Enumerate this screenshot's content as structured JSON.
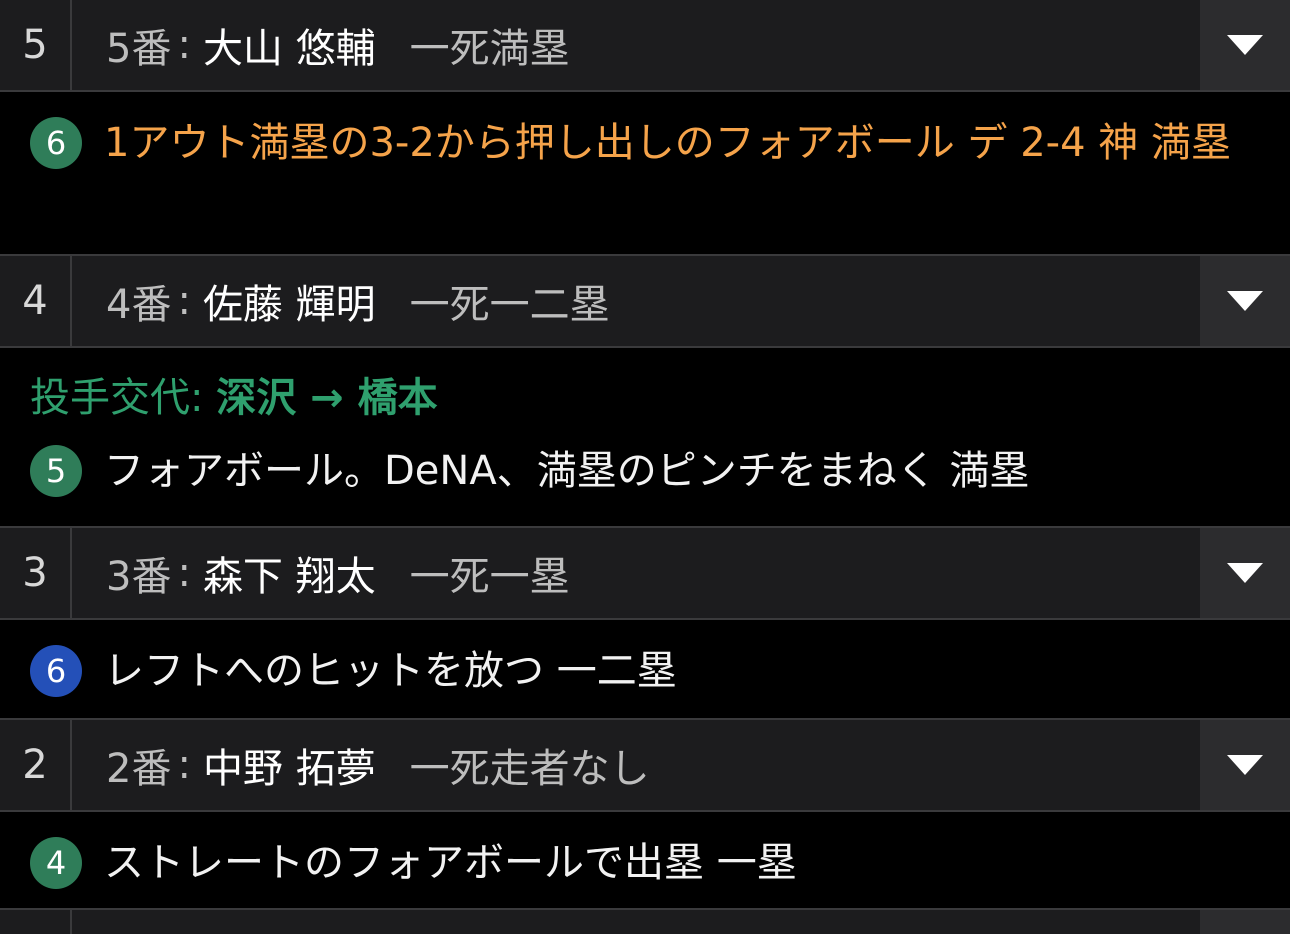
{
  "rows": [
    {
      "order": "5",
      "batter_label": "5番",
      "sep": ":",
      "name": "大山 悠輔",
      "outs": "一死満塁",
      "event": {
        "badge": "6",
        "badge_color": "#2f7d59",
        "text": "1アウト満塁の3-2から押し出しのフォアボール デ 2-4 神 満塁",
        "highlight": true
      }
    },
    {
      "order": "4",
      "batter_label": "4番",
      "sep": ":",
      "name": "佐藤 輝明",
      "outs": "一死一二塁",
      "pitcher_change": {
        "label": "投手交代:",
        "names": "深沢 → 橋本"
      },
      "event": {
        "badge": "5",
        "badge_color": "#2f7d59",
        "text": "フォアボール。DeNA、満塁のピンチをまねく 満塁",
        "highlight": false
      }
    },
    {
      "order": "3",
      "batter_label": "3番",
      "sep": ":",
      "name": "森下 翔太",
      "outs": "一死一塁",
      "event": {
        "badge": "6",
        "badge_color": "#2450b8",
        "text": "レフトへのヒットを放つ 一二塁",
        "highlight": false
      }
    },
    {
      "order": "2",
      "batter_label": "2番",
      "sep": ":",
      "name": "中野 拓夢",
      "outs": "一死走者なし",
      "event": {
        "badge": "4",
        "badge_color": "#2f7d59",
        "text": "ストレートのフォアボールで出塁 一塁",
        "highlight": false
      }
    }
  ],
  "icons": {
    "toggle": "chevron-down-icon"
  },
  "colors": {
    "highlight_text": "#f5a34a",
    "pitcher_change": "#2fa06e",
    "badge_green": "#2f7d59",
    "badge_blue": "#2450b8"
  }
}
